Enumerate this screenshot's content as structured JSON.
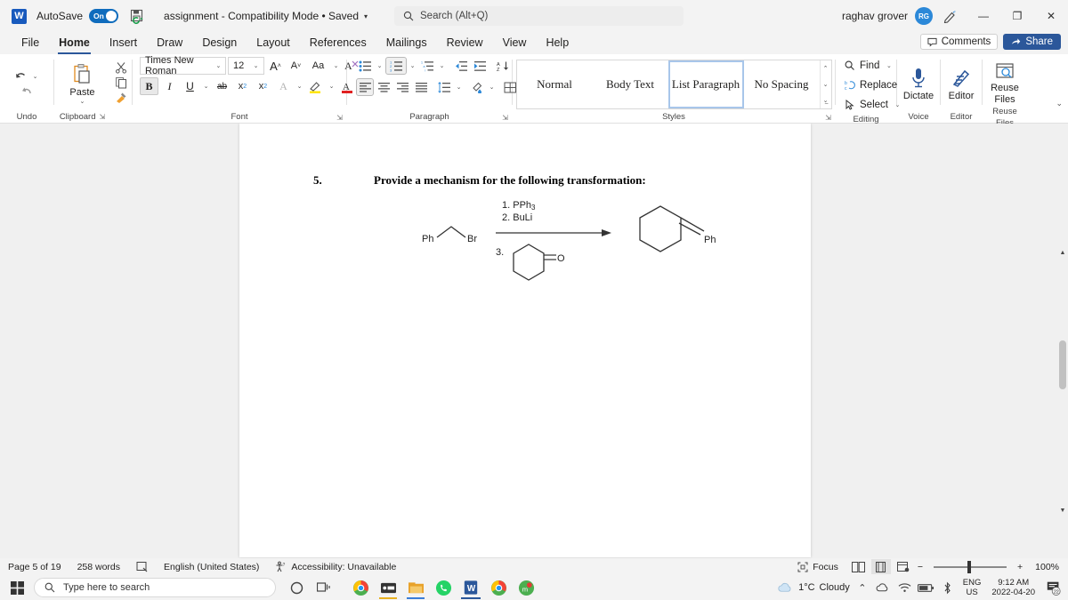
{
  "titlebar": {
    "app_icon": "word-logo-icon",
    "autosave_label": "AutoSave",
    "autosave_state": "On",
    "doc_title": "assignment  -  Compatibility Mode • Saved",
    "user_name": "raghav grover",
    "user_initials": "RG",
    "minimize": "—",
    "restore": "❐",
    "close": "✕"
  },
  "search": {
    "placeholder": "Search (Alt+Q)"
  },
  "tabs": [
    {
      "label": "File",
      "active": false
    },
    {
      "label": "Home",
      "active": true
    },
    {
      "label": "Insert",
      "active": false
    },
    {
      "label": "Draw",
      "active": false
    },
    {
      "label": "Design",
      "active": false
    },
    {
      "label": "Layout",
      "active": false
    },
    {
      "label": "References",
      "active": false
    },
    {
      "label": "Mailings",
      "active": false
    },
    {
      "label": "Review",
      "active": false
    },
    {
      "label": "View",
      "active": false
    },
    {
      "label": "Help",
      "active": false
    }
  ],
  "tabstrip_right": {
    "comments": "Comments",
    "share": "Share"
  },
  "ribbon": {
    "undo": {
      "label": "Undo",
      "undo_icon": "undo-arrow-icon",
      "redo_icon": "redo-arrow-icon"
    },
    "clipboard": {
      "label": "Clipboard",
      "paste_label": "Paste",
      "cut_icon": "scissors-icon",
      "copy_icon": "copy-icon",
      "format_painter_icon": "format-painter-icon"
    },
    "font": {
      "label": "Font",
      "font_name": "Times New Roman",
      "font_size": "12",
      "grow_font": "A",
      "shrink_font": "A",
      "change_case": "Aa",
      "clear_formatting": "A",
      "bold": "B",
      "italic": "I",
      "underline": "U",
      "strikethrough": "ab",
      "subscript": "x",
      "superscript": "x",
      "text_effects": "A",
      "highlight": "A",
      "font_color": "A"
    },
    "paragraph": {
      "label": "Paragraph",
      "bullets": "bullet-list-icon",
      "numbering": "numbered-list-icon",
      "multilevel": "multilevel-list-icon",
      "decrease_indent": "decrease-indent-icon",
      "increase_indent": "increase-indent-icon",
      "sort": "sort-az-icon",
      "show_marks": "¶",
      "align_left": "align-left-icon",
      "align_center": "align-center-icon",
      "align_right": "align-right-icon",
      "justify": "justify-icon",
      "line_spacing": "line-spacing-icon",
      "shading": "shading-icon",
      "borders": "borders-icon"
    },
    "styles": {
      "label": "Styles",
      "items": [
        {
          "name": "Normal",
          "selected": false
        },
        {
          "name": "Body Text",
          "selected": false
        },
        {
          "name": "List Paragraph",
          "selected": true
        },
        {
          "name": "No Spacing",
          "selected": false
        }
      ]
    },
    "editing": {
      "label": "Editing",
      "find": "Find",
      "replace": "Replace",
      "select": "Select"
    },
    "voice": {
      "label": "Voice",
      "dictate": "Dictate"
    },
    "editor_group": {
      "label": "Editor",
      "editor": "Editor"
    },
    "reuse": {
      "label": "Reuse Files",
      "reuse_files": "Reuse\nFiles",
      "line1": "Reuse",
      "line2": "Files"
    }
  },
  "document": {
    "question_number": "5.",
    "question_text": "Provide a mechanism for the following transformation:",
    "scheme": {
      "reactant_label_left": "Ph",
      "reactant_label_right": "Br",
      "reagent_1": "1. PPh",
      "reagent_1_sub": "3",
      "reagent_2": "2. BuLi",
      "reagent_3": "3.",
      "ketone_oxygen": "O",
      "product_label": "Ph"
    }
  },
  "statusbar": {
    "page": "Page 5 of 19",
    "words": "258 words",
    "proofing_icon": "proofing-errors-icon",
    "language": "English (United States)",
    "accessibility": "Accessibility: Unavailable",
    "focus": "Focus",
    "view_read": "read-mode-icon",
    "view_print": "print-layout-icon",
    "view_web": "web-layout-icon",
    "zoom_minus": "−",
    "zoom_plus": "+",
    "zoom_level": "100%"
  },
  "taskbar": {
    "start_icon": "windows-start-icon",
    "search_placeholder": "Type here to search",
    "apps": [
      {
        "name": "task-view-icon"
      },
      {
        "name": "cortana-icon"
      },
      {
        "name": "chrome-icon"
      },
      {
        "name": "media-icon"
      },
      {
        "name": "files-icon"
      },
      {
        "name": "whatsapp-icon"
      },
      {
        "name": "word-taskbar-icon"
      },
      {
        "name": "chrome2-icon"
      },
      {
        "name": "teams-icon"
      }
    ],
    "weather_temp": "1°C",
    "weather_desc": "Cloudy",
    "tray": [
      "chevron-up-icon",
      "onedrive-icon",
      "wifi-icon",
      "battery-icon",
      "bluetooth-icon"
    ],
    "lang_line1": "ENG",
    "lang_line2": "US",
    "time": "9:12 AM",
    "date": "2022-04-20",
    "notification_count": "22"
  },
  "colors": {
    "accent": "#2b579a",
    "word_blue": "#185abd",
    "toggle_on": "#0f6cbd",
    "avatar": "#2b88d8",
    "selection_border": "#a8c6ea"
  }
}
